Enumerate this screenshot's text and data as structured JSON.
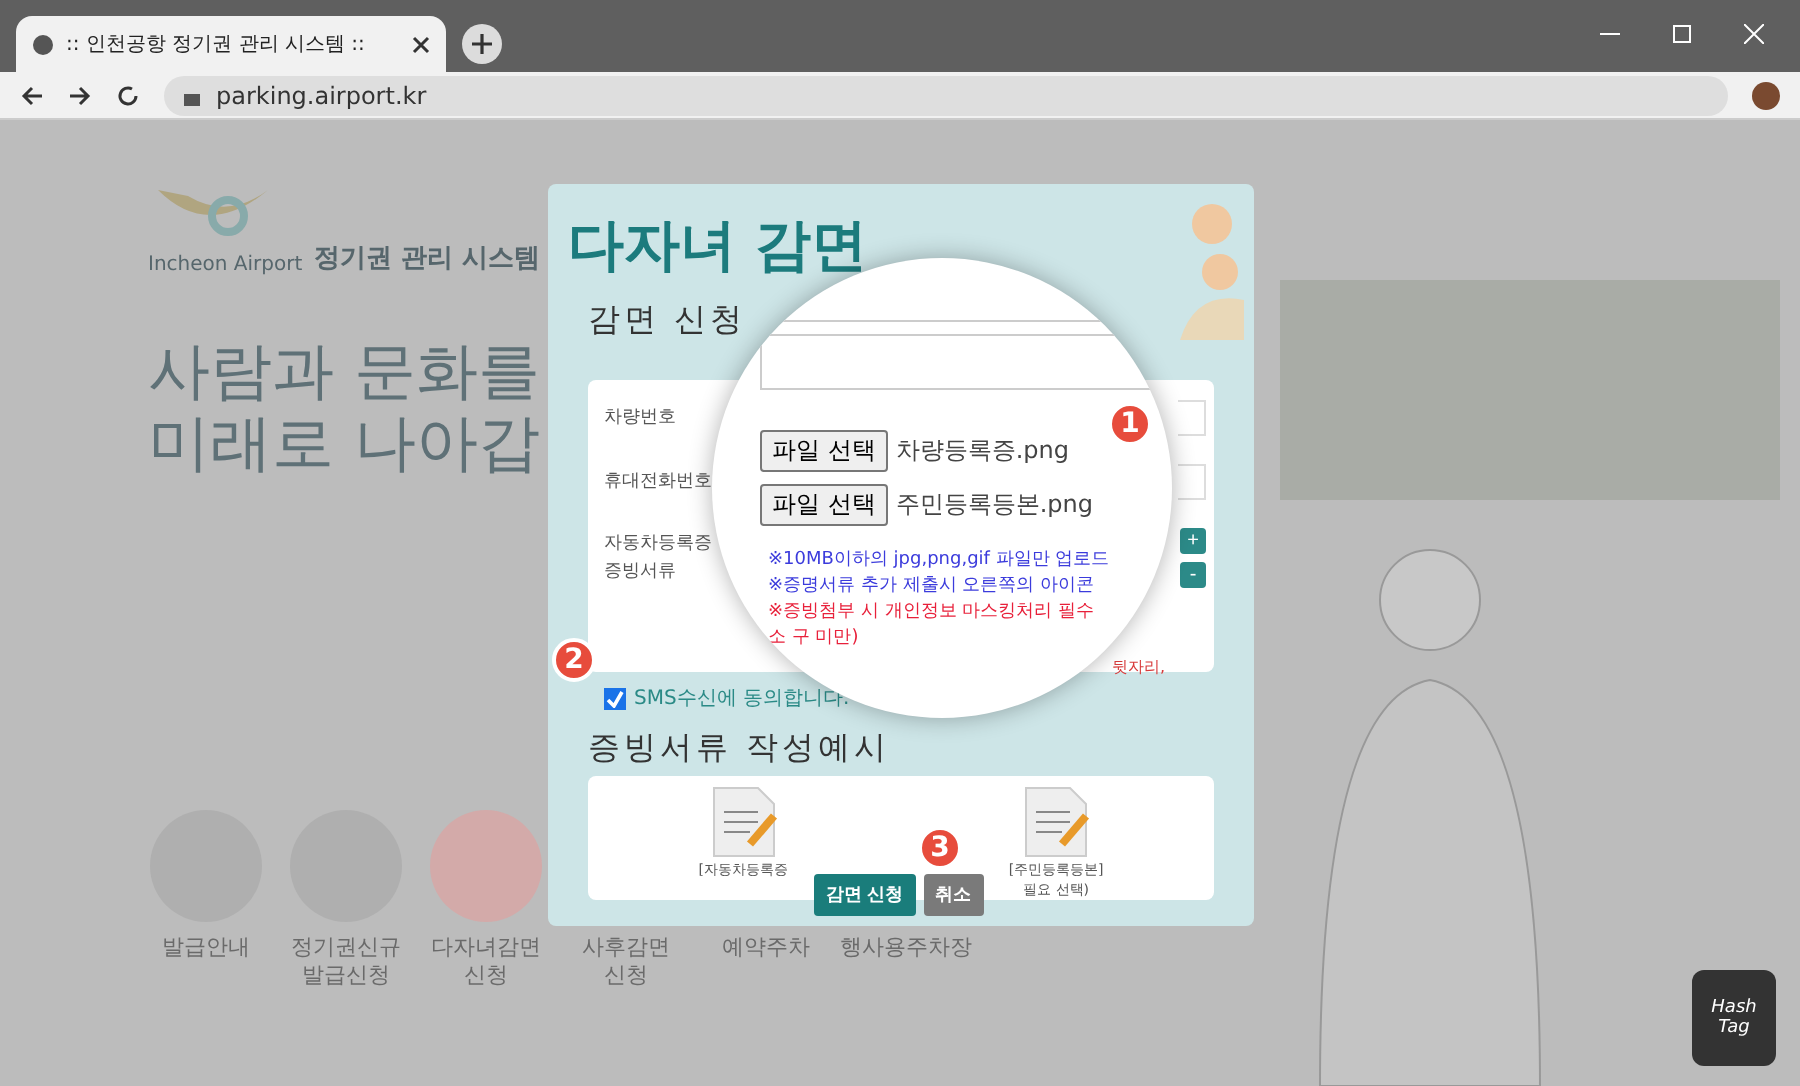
{
  "browser": {
    "tab_title": ":: 인천공항 정기권 관리 시스템 ::",
    "url": "parking.airport.kr"
  },
  "site": {
    "logo_text": "Incheon Airport",
    "system_name": "정기권 관리 시스템",
    "hero_lines": [
      "사람과 문화를",
      "미래로 나아갑"
    ],
    "menu": [
      {
        "label": "발급안내"
      },
      {
        "label": "정기권신규\n발급신청"
      },
      {
        "label": "다자녀감면\n신청"
      },
      {
        "label": "사후감면\n신청"
      },
      {
        "label": "예약주차"
      },
      {
        "label": "행사용주차장"
      }
    ]
  },
  "modal": {
    "title": "다자녀 감면",
    "section_title": "감면 신청",
    "fields": [
      {
        "label": "차량번호"
      },
      {
        "label": "휴대전화번호"
      },
      {
        "label": "자동차등록증\n증빙서류"
      }
    ],
    "add_button": "+",
    "remove_button": "-",
    "notes_fragment": "뒷자리,",
    "sms": {
      "label": "SMS수신에 동의합니다.",
      "checked": true
    },
    "example_title": "증빙서류 작성예시",
    "examples": [
      {
        "caption": "[자동차등록증"
      },
      {
        "caption": "[주민등록등본]\n필요 선택)"
      }
    ],
    "buttons": [
      {
        "label": "감면 신청",
        "kind": "primary"
      },
      {
        "label": "취소",
        "kind": "secondary"
      }
    ]
  },
  "magnifier": {
    "files": [
      {
        "button": "파일 선택",
        "file": "차량등록증.png"
      },
      {
        "button": "파일 선택",
        "file": "주민등록등본.png"
      }
    ],
    "notes": [
      {
        "text": "※10MB이하의 jpg,png,gif 파일만 업로드",
        "kind": "info"
      },
      {
        "text": "※증명서류 추가 제출시 오른쪽의 아이콘",
        "kind": "info"
      },
      {
        "text": "※증빙첨부 시 개인정보 마스킹처리 필수",
        "kind": "warning"
      },
      {
        "text": "소 구 미만)",
        "kind": "warning"
      }
    ]
  },
  "callouts": [
    {
      "label": "1"
    },
    {
      "label": "2"
    },
    {
      "label": "3"
    }
  ],
  "watermark_logo": [
    "Hash",
    "Tag"
  ]
}
